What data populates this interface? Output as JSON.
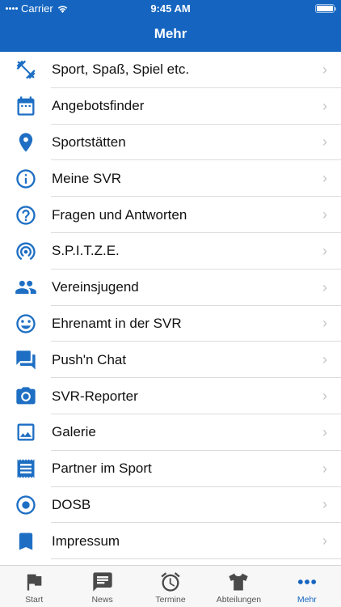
{
  "status_bar": {
    "carrier": "Carrier",
    "time": "9:45 AM"
  },
  "header": {
    "title": "Mehr"
  },
  "menu": {
    "items": [
      {
        "label": "Sport, Spaß, Spiel etc.",
        "icon": "dumbbell-icon"
      },
      {
        "label": "Angebotsfinder",
        "icon": "calendar-icon"
      },
      {
        "label": "Sportstätten",
        "icon": "location-pin-icon"
      },
      {
        "label": "Meine SVR",
        "icon": "info-icon"
      },
      {
        "label": "Fragen und Antworten",
        "icon": "help-icon"
      },
      {
        "label": "S.P.I.T.Z.E.",
        "icon": "broadcast-icon"
      },
      {
        "label": "Vereinsjugend",
        "icon": "people-icon"
      },
      {
        "label": "Ehrenamt in der SVR",
        "icon": "smiley-icon"
      },
      {
        "label": "Push'n Chat",
        "icon": "chat-icon"
      },
      {
        "label": "SVR-Reporter",
        "icon": "camera-icon"
      },
      {
        "label": "Galerie",
        "icon": "image-icon"
      },
      {
        "label": "Partner im Sport",
        "icon": "receipt-icon"
      },
      {
        "label": "DOSB",
        "icon": "target-icon"
      },
      {
        "label": "Impressum",
        "icon": "bookmark-icon"
      }
    ]
  },
  "tabbar": {
    "tabs": [
      {
        "label": "Start",
        "icon": "flag-icon"
      },
      {
        "label": "News",
        "icon": "news-icon"
      },
      {
        "label": "Termine",
        "icon": "alarm-clock-icon"
      },
      {
        "label": "Abteilungen",
        "icon": "shirt-icon"
      },
      {
        "label": "Mehr",
        "icon": "more-dots-icon"
      }
    ],
    "active": "Mehr"
  },
  "colors": {
    "accent": "#1565c0",
    "icon": "#1e6fc4",
    "separator": "#dcdcdc"
  }
}
